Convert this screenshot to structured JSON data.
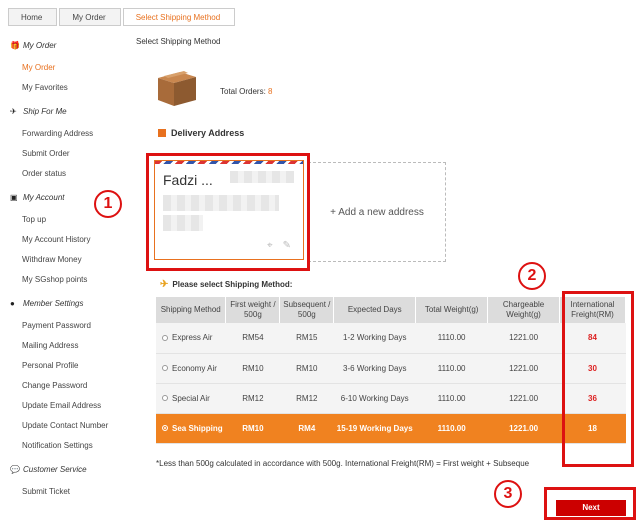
{
  "breadcrumb": [
    "Home",
    "My Order",
    "Select Shipping Method"
  ],
  "sidebar": {
    "sections": [
      {
        "title": "My Order",
        "icon": "gift-icon",
        "items": [
          "My Order",
          "My Favorites"
        ]
      },
      {
        "title": "Ship For Me",
        "icon": "plane-icon",
        "items": [
          "Forwarding Address",
          "Submit Order",
          "Order status"
        ]
      },
      {
        "title": "My Account",
        "icon": "id-card-icon",
        "items": [
          "Top up",
          "My Account History",
          "Withdraw Money",
          "My SGshop points"
        ]
      },
      {
        "title": "Member Settings",
        "icon": "user-icon",
        "items": [
          "Payment Password",
          "Mailing Address",
          "Personal Profile",
          "Change Password",
          "Update Email Address",
          "Update Contact Number",
          "Notification Settings"
        ]
      },
      {
        "title": "Customer Service",
        "icon": "chat-icon",
        "items": [
          "Submit Ticket"
        ]
      }
    ],
    "active_item": "My Order"
  },
  "page_title": "Select Shipping Method",
  "orders": {
    "label": "Total Orders:",
    "count": "8"
  },
  "delivery": {
    "heading": "Delivery Address",
    "card_name": "Fadzi ...",
    "add_label": "+ Add a new address"
  },
  "shipping": {
    "label": "Please select Shipping Method:",
    "headers": [
      "Shipping Method",
      "First weight / 500g",
      "Subsequent / 500g",
      "Expected Days",
      "Total Weight(g)",
      "Chargeable Weight(g)",
      "International Freight(RM)"
    ],
    "rows": [
      {
        "method": "Express Air",
        "first": "RM54",
        "subsequent": "RM15",
        "days": "1-2 Working Days",
        "total": "1110.00",
        "chargeable": "1221.00",
        "freight": "84",
        "selected": false
      },
      {
        "method": "Economy Air",
        "first": "RM10",
        "subsequent": "RM10",
        "days": "3-6 Working Days",
        "total": "1110.00",
        "chargeable": "1221.00",
        "freight": "30",
        "selected": false
      },
      {
        "method": "Special Air",
        "first": "RM12",
        "subsequent": "RM12",
        "days": "6-10 Working Days",
        "total": "1110.00",
        "chargeable": "1221.00",
        "freight": "36",
        "selected": false
      },
      {
        "method": "Sea Shipping",
        "first": "RM10",
        "subsequent": "RM4",
        "days": "15-19 Working Days",
        "total": "1110.00",
        "chargeable": "1221.00",
        "freight": "18",
        "selected": true
      }
    ],
    "footnote": "*Less than 500g calculated in accordance with 500g. International Freight(RM) = First weight + Subseque"
  },
  "next_label": "Next",
  "annotations": [
    "1",
    "2",
    "3"
  ],
  "colors": {
    "accent": "#e8711f",
    "selected_row": "#f08220",
    "annotation": "#dd1111",
    "next_button": "#cc0000"
  }
}
